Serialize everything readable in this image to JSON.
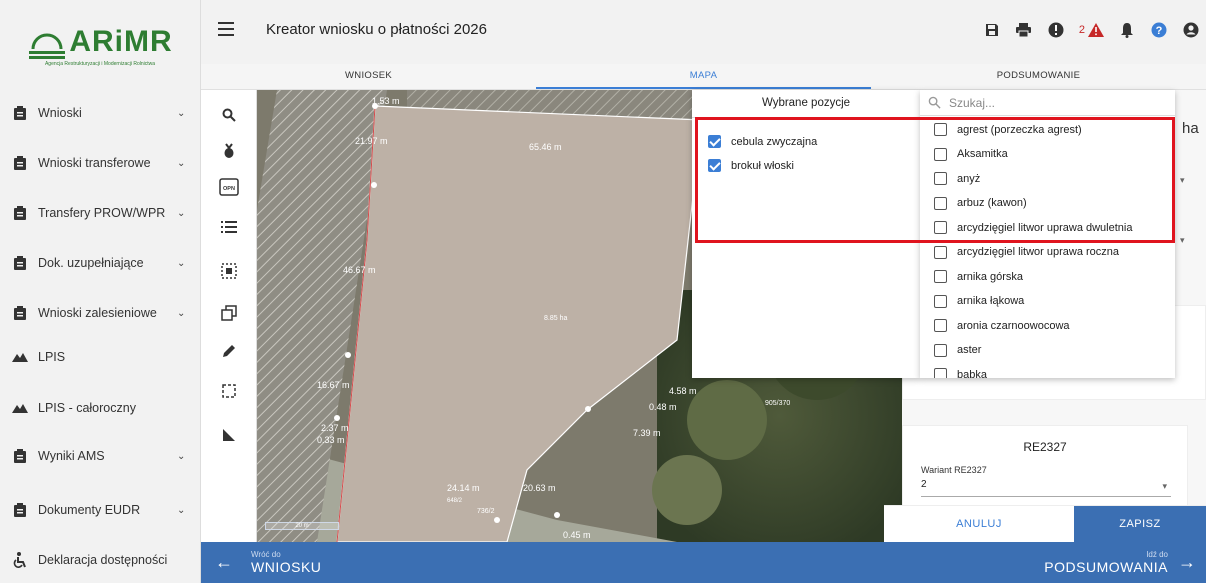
{
  "logo": {
    "name": "ARiMR",
    "subtitle": "Agencja Restrukturyzacji i Modernizacji Rolnictwa"
  },
  "sidebar": {
    "items": [
      {
        "label": "Wnioski",
        "icon": "clipboard-icon",
        "chevron": true
      },
      {
        "label": "Wnioski transferowe",
        "icon": "clipboard-icon",
        "chevron": true
      },
      {
        "label": "Transfery PROW/WPR",
        "icon": "clipboard-icon",
        "chevron": true
      },
      {
        "label": "Dok. uzupełniające",
        "icon": "clipboard-icon",
        "chevron": true
      },
      {
        "label": "Wnioski zalesieniowe",
        "icon": "clipboard-icon",
        "chevron": true
      },
      {
        "label": "LPIS",
        "icon": "terrain-icon",
        "chevron": false
      },
      {
        "label": "LPIS - całoroczny",
        "icon": "terrain-icon",
        "chevron": false
      },
      {
        "label": "Wyniki AMS",
        "icon": "clipboard-icon",
        "chevron": true
      },
      {
        "label": "Dokumenty EUDR",
        "icon": "clipboard-icon",
        "chevron": true
      },
      {
        "label": "Deklaracja dostępności",
        "icon": "accessibility-icon",
        "chevron": false
      }
    ]
  },
  "header": {
    "title": "Kreator wniosku o płatności 2026",
    "notification_count": "2"
  },
  "tabs": [
    {
      "label": "WNIOSEK",
      "active": false
    },
    {
      "label": "MAPA",
      "active": true
    },
    {
      "label": "PODSUMOWANIE",
      "active": false
    }
  ],
  "map": {
    "area_label": "8.85 ha",
    "measurements": [
      "1.53 m",
      "21.97 m",
      "65.46 m",
      "46.67 m",
      "16.67 m",
      "2.37 m",
      "0.33 m",
      "4.58 m",
      "0.48 m",
      "7.39 m",
      "24.14 m",
      "20.63 m",
      "0.45 m"
    ],
    "parcels": [
      "905/370",
      "736/2",
      "648/2"
    ],
    "scale": "20 m"
  },
  "selected_panel": {
    "title": "Wybrane pozycje",
    "items": [
      {
        "label": "cebula zwyczajna",
        "checked": true
      },
      {
        "label": "brokuł włoski",
        "checked": true
      }
    ]
  },
  "list_panel": {
    "search_placeholder": "Szukaj...",
    "items": [
      {
        "label": "agrest (porzeczka agrest)",
        "checked": false
      },
      {
        "label": "Aksamitka",
        "checked": false
      },
      {
        "label": "anyż",
        "checked": false
      },
      {
        "label": "arbuz (kawon)",
        "checked": false
      },
      {
        "label": "arcydzięgiel litwor uprawa dwuletnia",
        "checked": false
      },
      {
        "label": "arcydzięgiel litwor uprawa roczna",
        "checked": false
      },
      {
        "label": "arnika górska",
        "checked": false
      },
      {
        "label": "arnika łąkowa",
        "checked": false
      },
      {
        "label": "aronia czarnoowocowa",
        "checked": false
      },
      {
        "label": "aster",
        "checked": false
      },
      {
        "label": "babka",
        "checked": false
      }
    ]
  },
  "right_panel": {
    "partial_text": "ha",
    "variant_card": {
      "title": "RE2327",
      "field_label": "Wariant RE2327",
      "field_value": "2"
    }
  },
  "buttons": {
    "cancel": "ANULUJ",
    "save": "ZAPISZ"
  },
  "footer": {
    "back_small": "Wróć do",
    "back_big": "WNIOSKU",
    "next_small": "Idź do",
    "next_big": "PODSUMOWANIA"
  },
  "colors": {
    "brand_green": "#2e7d32",
    "accent_blue": "#3b6fb3",
    "highlight_red": "#e0141e",
    "warning_red": "#c62828"
  }
}
